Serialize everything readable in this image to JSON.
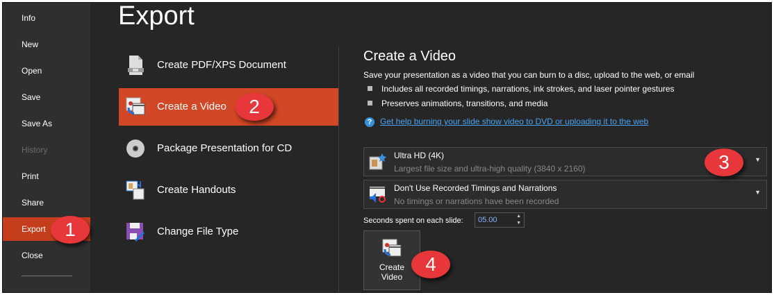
{
  "sidebar": {
    "items": [
      {
        "label": "Info"
      },
      {
        "label": "New"
      },
      {
        "label": "Open"
      },
      {
        "label": "Save"
      },
      {
        "label": "Save As"
      },
      {
        "label": "History"
      },
      {
        "label": "Print"
      },
      {
        "label": "Share"
      },
      {
        "label": "Export"
      },
      {
        "label": "Close"
      }
    ]
  },
  "page_title": "Export",
  "export_options": [
    {
      "label": "Create PDF/XPS Document"
    },
    {
      "label": "Create a Video"
    },
    {
      "label": "Package Presentation for CD"
    },
    {
      "label": "Create Handouts"
    },
    {
      "label": "Change File Type"
    }
  ],
  "panel": {
    "title": "Create a Video",
    "description": "Save your presentation as a video that you can burn to a disc, upload to the web, or email",
    "bullets": [
      "Includes all recorded timings, narrations, ink strokes, and laser pointer gestures",
      "Preserves animations, transitions, and media"
    ],
    "help_link": "Get help burning your slide show video to DVD or uploading it to the web",
    "quality": {
      "title": "Ultra HD (4K)",
      "subtitle": "Largest file size and ultra-high quality (3840 x 2160)"
    },
    "timings": {
      "title": "Don't Use Recorded Timings and Narrations",
      "subtitle": "No timings or narrations have been recorded"
    },
    "seconds_label": "Seconds spent on each slide:",
    "seconds_value": "05.00",
    "create_button": [
      "Create",
      "Video"
    ]
  },
  "badges": [
    "1",
    "2",
    "3",
    "4"
  ],
  "colors": {
    "accent": "#d24726",
    "sidebar_active": "#c43e1c",
    "badge": "#e8373a",
    "link": "#4aa3f0"
  }
}
